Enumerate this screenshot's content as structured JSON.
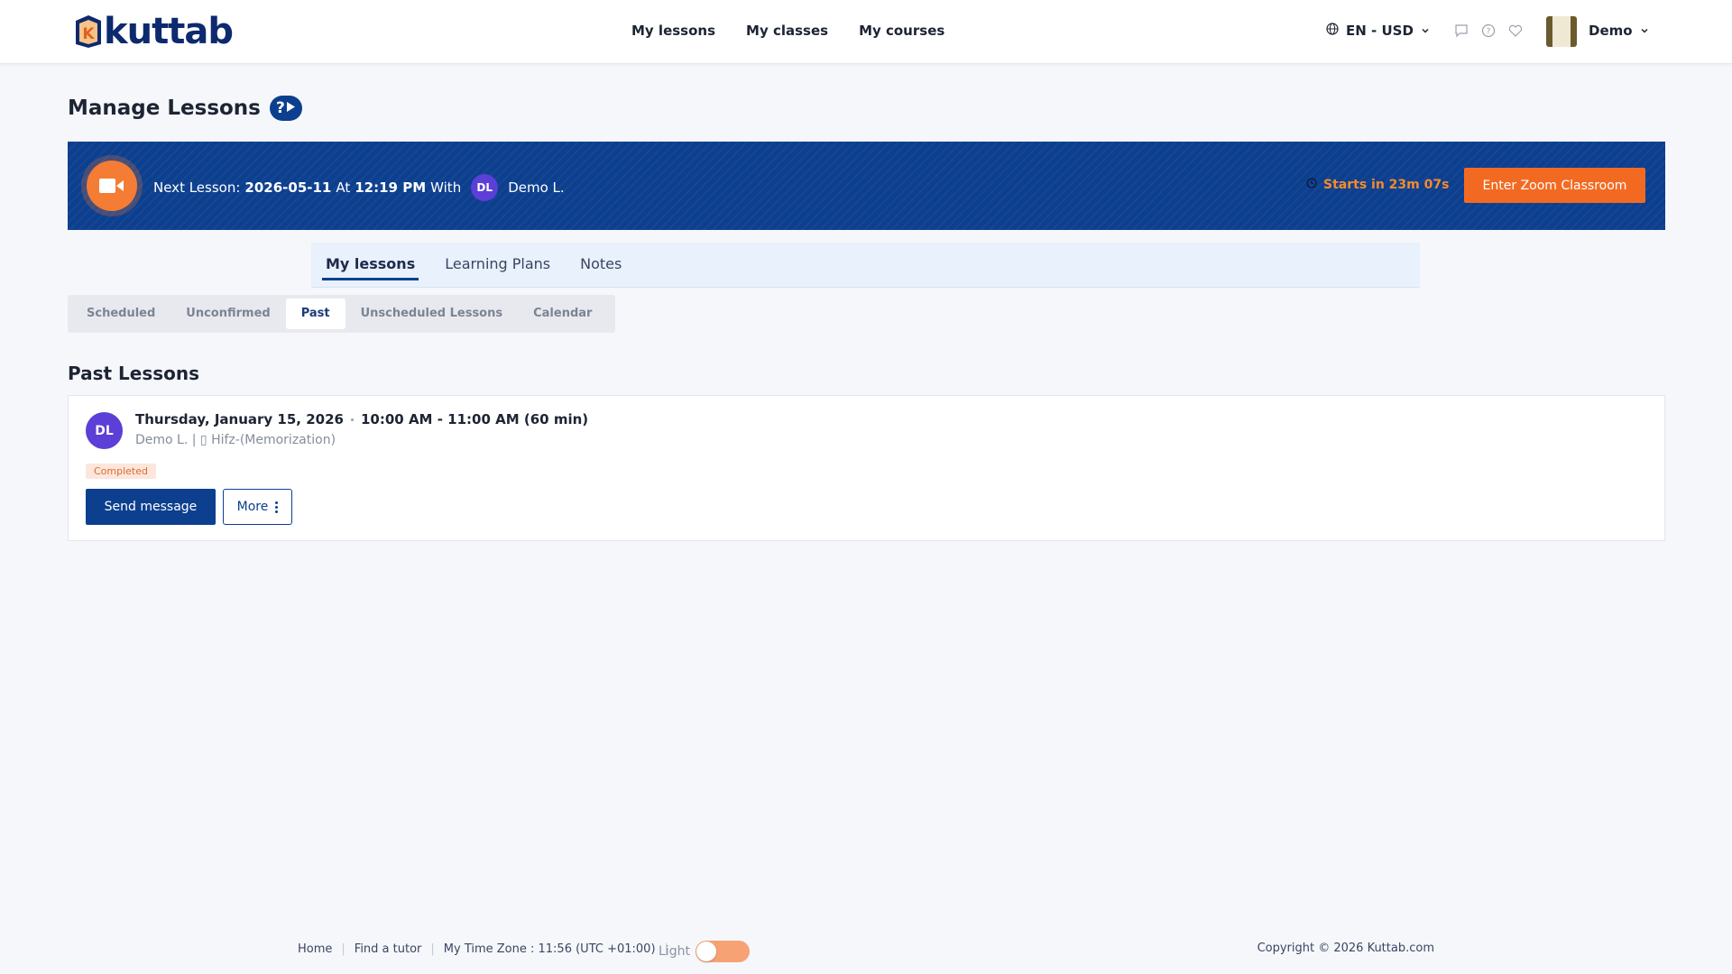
{
  "brand": {
    "name": "kuttab",
    "accent": "#0d3f8f",
    "orange": "#f26a22"
  },
  "nav": {
    "items": [
      "My lessons",
      "My classes",
      "My courses"
    ]
  },
  "header": {
    "language": "EN - USD",
    "icons": [
      "chat-icon",
      "help-icon",
      "heart-icon"
    ],
    "user_name": "Demo"
  },
  "page": {
    "title": "Manage Lessons"
  },
  "banner": {
    "next_label": "Next Lesson:",
    "date": "2026-05-11",
    "at_label": "At",
    "time": "12:19 PM",
    "with_label": "With",
    "tutor_initials": "DL",
    "tutor_name": "Demo L.",
    "starts_text": "Starts in 23m 07s",
    "zoom_button": "Enter Zoom Classroom"
  },
  "main_tabs": [
    {
      "label": "My lessons",
      "active": true
    },
    {
      "label": "Learning Plans",
      "active": false
    },
    {
      "label": "Notes",
      "active": false
    }
  ],
  "sub_tabs": [
    {
      "label": "Scheduled",
      "active": false
    },
    {
      "label": "Unconfirmed",
      "active": false
    },
    {
      "label": "Past",
      "active": true
    },
    {
      "label": "Unscheduled Lessons",
      "active": false
    },
    {
      "label": "Calendar",
      "active": false
    }
  ],
  "past": {
    "section_title": "Past Lessons",
    "lessons": [
      {
        "initials": "DL",
        "date": "Thursday, January 15, 2026",
        "time": "10:00 AM - 11:00 AM (60 min)",
        "subtitle": "Demo L. | ▯ Hifz-(Memorization)",
        "status": "Completed",
        "send_label": "Send message",
        "more_label": "More"
      }
    ]
  },
  "footer": {
    "links": [
      "Home",
      "Find a tutor",
      "My Time Zone : 11:56 (UTC +01:00)"
    ],
    "theme_label": "Light",
    "copyright": "Copyright © 2026 Kuttab.com"
  }
}
